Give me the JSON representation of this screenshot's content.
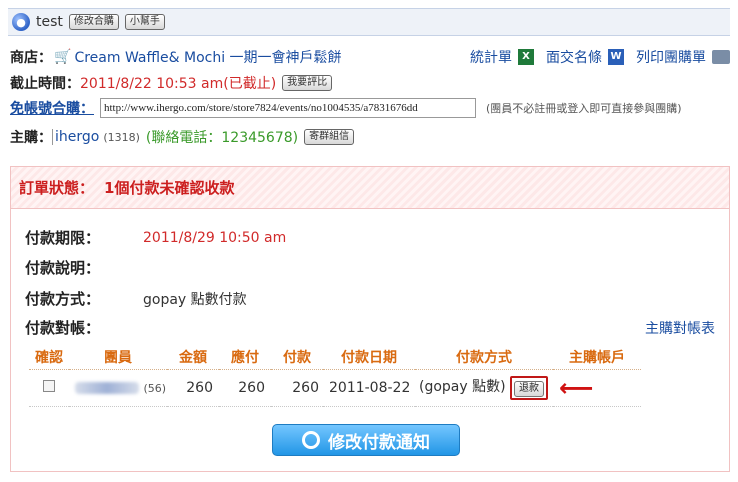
{
  "header": {
    "title": "test",
    "buttons": [
      "修改合購",
      "小幫手"
    ]
  },
  "store": {
    "label": "商店：",
    "name": "Cream Waffle& Mochi 一期一會神戶鬆餅",
    "links": {
      "stats": "統計單",
      "exchange": "面交名條",
      "print": "列印團購單"
    }
  },
  "deadline": {
    "label": "截止時間：",
    "value": "2011/8/22  10:53 am(已截止)",
    "button": "我要評比"
  },
  "free_account": {
    "label": "免帳號合購：",
    "url": "http://www.ihergo.com/store/store7824/events/no1004535/a7831676dd",
    "note": "(團員不必註冊或登入即可直接參與團購)"
  },
  "host": {
    "label": "主購：",
    "name": "ihergo",
    "count": "(1318)",
    "contact": "(聯絡電話：12345678)",
    "button": "寄群組信"
  },
  "order": {
    "status_label": "訂單狀態：",
    "status_value": "1個付款未確認收款",
    "deadline_label": "付款期限：",
    "deadline_value": "2011/8/29  10:50 am",
    "desc_label": "付款說明：",
    "method_label": "付款方式：",
    "method_value": "gopay 點數付款",
    "recon_label": "付款對帳：",
    "recon_link": "主購對帳表"
  },
  "table": {
    "headers": [
      "確認",
      "團員",
      "金額",
      "應付",
      "付款",
      "付款日期",
      "付款方式",
      "主購帳戶"
    ],
    "row": {
      "member_count": "(56)",
      "amount": "260",
      "due": "260",
      "paid": "260",
      "date": "2011-08-22",
      "method": "(gopay 點數)",
      "refund": "退款"
    }
  },
  "action_button": "修改付款通知"
}
